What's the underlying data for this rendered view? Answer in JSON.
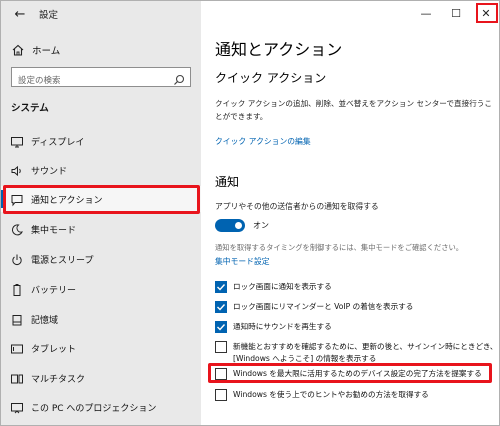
{
  "window": {
    "title": "設定",
    "minimize": "—",
    "maximize": "☐",
    "close": "✕"
  },
  "sidebar": {
    "back": "←",
    "home": "ホーム",
    "search_placeholder": "設定の検索",
    "section": "システム",
    "items": [
      {
        "label": "ディスプレイ",
        "icon": "monitor-icon"
      },
      {
        "label": "サウンド",
        "icon": "speaker-icon"
      },
      {
        "label": "通知とアクション",
        "icon": "notification-icon"
      },
      {
        "label": "集中モード",
        "icon": "moon-icon"
      },
      {
        "label": "電源とスリープ",
        "icon": "power-icon"
      },
      {
        "label": "バッテリー",
        "icon": "battery-icon"
      },
      {
        "label": "記憶域",
        "icon": "storage-icon"
      },
      {
        "label": "タブレット",
        "icon": "tablet-icon"
      },
      {
        "label": "マルチタスク",
        "icon": "multitask-icon"
      },
      {
        "label": "この PC へのプロジェクション",
        "icon": "projection-icon"
      }
    ]
  },
  "main": {
    "title": "通知とアクション",
    "quick_actions": {
      "heading": "クイック アクション",
      "desc": "クイック アクションの追加、削除、並べ替えをアクション センターで直接行うことができます。",
      "edit_link": "クイック アクションの編集"
    },
    "notifications": {
      "heading": "通知",
      "get_label": "アプリやその他の送信者からの通知を取得する",
      "toggle_state": "オン",
      "focus_desc": "通知を取得するタイミングを制御するには、集中モードをご確認ください。",
      "focus_link": "集中モード設定",
      "checks": [
        {
          "label": "ロック画面に通知を表示する",
          "checked": true
        },
        {
          "label": "ロック画面にリマインダーと VoIP の着信を表示する",
          "checked": true
        },
        {
          "label": "通知時にサウンドを再生する",
          "checked": true
        },
        {
          "label": "新機能とおすすめを確認するために、更新の後と、サインイン時にときどき、[Windows へようこそ] の情報を表示する",
          "checked": false
        },
        {
          "label": "Windows を最大限に活用するためのデバイス設定の完了方法を提案する",
          "checked": false
        },
        {
          "label": "Windows を使う上でのヒントやお勧めの方法を取得する",
          "checked": false
        }
      ]
    }
  },
  "colors": {
    "accent": "#0063b1",
    "highlight": "#e8141c",
    "sidebar_bg": "#e9e9e9"
  }
}
